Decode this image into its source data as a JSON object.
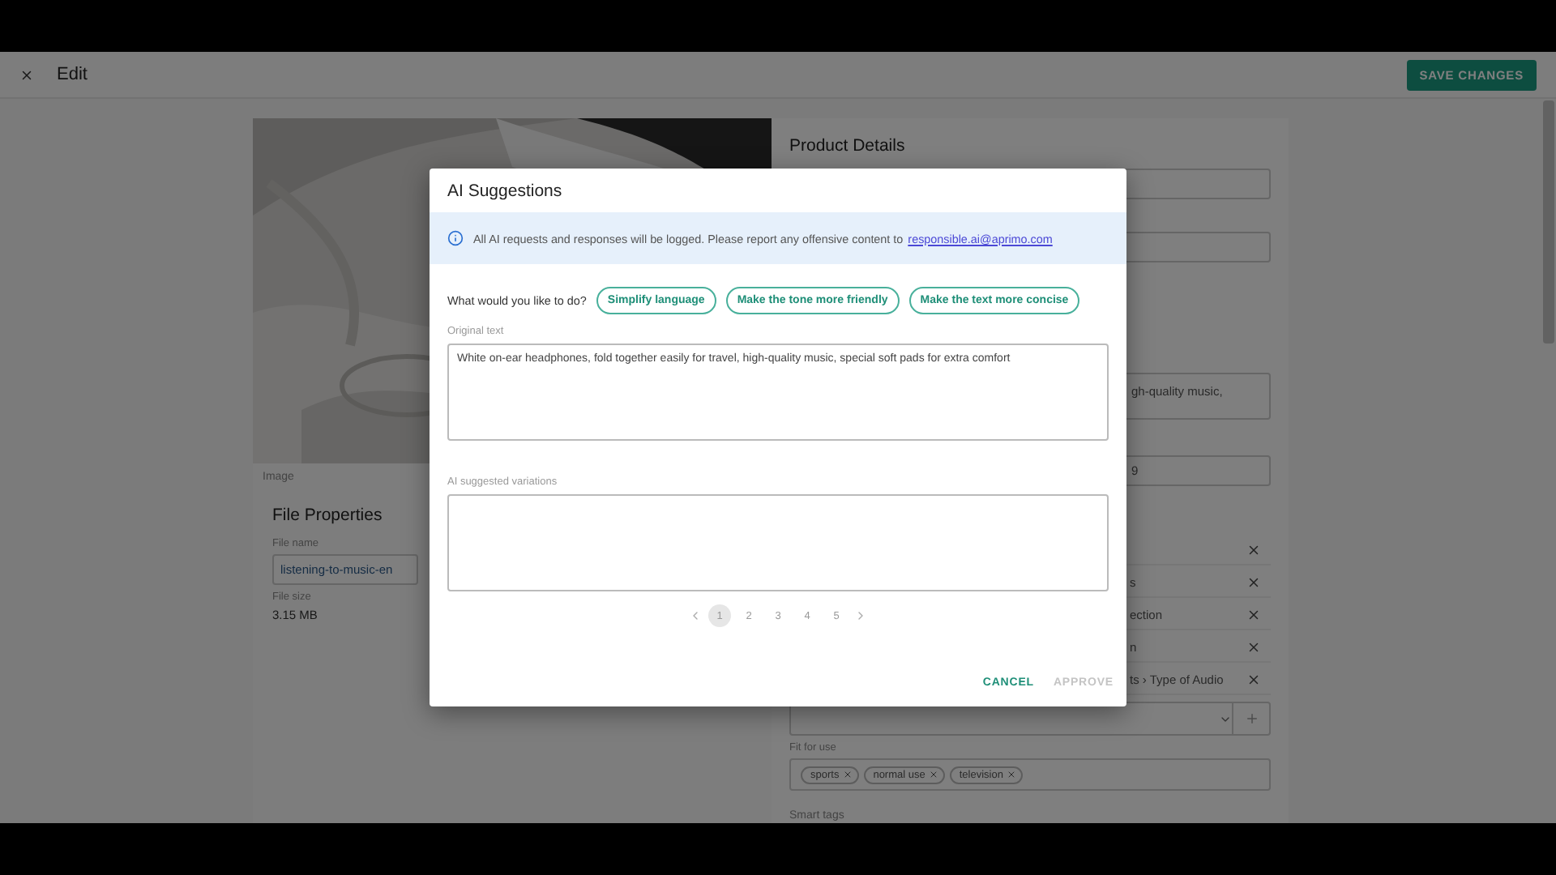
{
  "header": {
    "title": "Edit",
    "save_button": "SAVE CHANGES"
  },
  "image_label": "Image",
  "file_properties": {
    "title": "File Properties",
    "items": [
      {
        "kind": "field",
        "label": "File name",
        "value": "listening-to-music-en"
      },
      {
        "kind": "text",
        "label": "File size",
        "value": "3.15 MB"
      }
    ]
  },
  "product_details": {
    "title": "Product Details",
    "rows": [
      {
        "kind": "field",
        "value": ""
      },
      {
        "kind": "field",
        "value": ""
      },
      {
        "kind": "textarea",
        "value": "gh-quality music,"
      },
      {
        "kind": "field",
        "value": "9"
      },
      {
        "kind": "list_item",
        "value": ""
      },
      {
        "kind": "list_item",
        "value": "s"
      },
      {
        "kind": "list_item",
        "value": "ection"
      },
      {
        "kind": "list_item",
        "value": "n"
      },
      {
        "kind": "list_item",
        "value": "ts › Type of Audio"
      },
      {
        "kind": "select",
        "value": ""
      },
      {
        "kind": "chips",
        "label": "Fit for use",
        "chips": [
          "sports",
          "normal use",
          "television"
        ]
      },
      {
        "kind": "label",
        "value": "Smart tags"
      }
    ]
  },
  "dialog": {
    "title": "AI Suggestions",
    "notice": "All AI requests and responses will be logged. Please report any offensive content to",
    "notice_link": "responsible.ai@aprimo.com",
    "prompt": "What would you like to do?",
    "actions": [
      "Simplify language",
      "Make the tone more friendly",
      "Make the text more concise"
    ],
    "original_label": "Original text",
    "original_value": "White on-ear headphones, fold together easily for travel, high-quality music, special soft pads for extra comfort",
    "suggested_label": "AI suggested variations",
    "pages": [
      {
        "label": "1",
        "selected": true
      },
      {
        "label": "2",
        "selected": false
      },
      {
        "label": "3",
        "selected": false
      },
      {
        "label": "4",
        "selected": false
      },
      {
        "label": "5",
        "selected": false
      }
    ],
    "buttons": [
      {
        "label": "CANCEL",
        "disabled": false
      },
      {
        "label": "APPROVE",
        "disabled": true
      }
    ]
  }
}
